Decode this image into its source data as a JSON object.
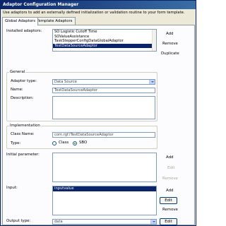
{
  "window": {
    "title": "Adaptor Configuration Manager",
    "description": "Use adaptors to add an externally defined initialization or validation routine to your form template."
  },
  "tabs": [
    {
      "label": "Global Adaptors"
    },
    {
      "label": "Template Adaptors"
    }
  ],
  "installed": {
    "label": "Installed adaptors:",
    "items": [
      {
        "label": "SO Logistic Cutoff Time"
      },
      {
        "label": "SOValueAssistance"
      },
      {
        "label": "TaskStepperConfigDataGlobalAdaptor"
      },
      {
        "label": "TestDataSourceAdaptor"
      }
    ],
    "buttons": {
      "add": "Add",
      "remove": "Remove",
      "duplicate": "Duplicate"
    }
  },
  "general": {
    "title": "General",
    "adaptor_type_label": "Adaptor type:",
    "adaptor_type_value": "Data Source",
    "name_label": "Name:",
    "name_value": "TestDataSourceAdaptor",
    "description_label": "Description:"
  },
  "implementation": {
    "title": "Implementation",
    "class_name_label": "Class Name:",
    "class_name_value": "com.rgf.ITestDataSourceAdaptor",
    "type_label": "Type:",
    "type_class": "Class",
    "type_sbo": "SBO"
  },
  "initial_parameter": {
    "label": "Initial parameter:",
    "buttons": {
      "add": "Add",
      "edit": "Edit",
      "remove": "Remove"
    }
  },
  "input": {
    "label": "Input:",
    "items": [
      {
        "label": "inputvalue"
      }
    ],
    "buttons": {
      "add": "Add",
      "edit": "Edit",
      "remove": "Remove"
    }
  },
  "output": {
    "label": "Output type:",
    "value": "data"
  }
}
